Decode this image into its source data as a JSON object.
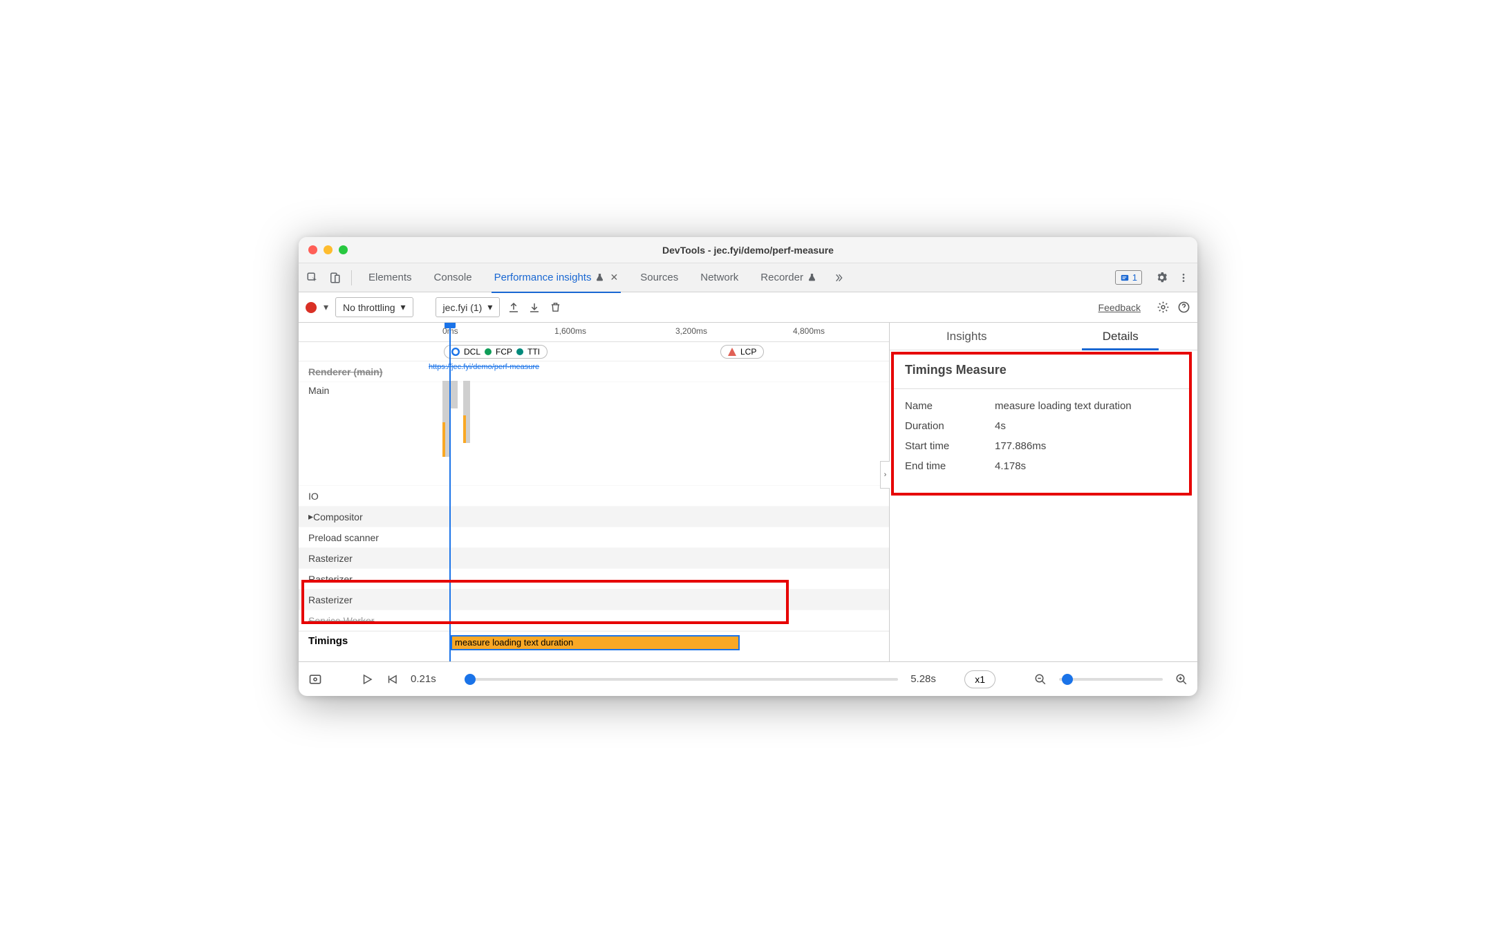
{
  "window": {
    "title": "DevTools - jec.fyi/demo/perf-measure"
  },
  "tabs": {
    "elements": "Elements",
    "console": "Console",
    "perf_insights": "Performance insights",
    "sources": "Sources",
    "network": "Network",
    "recorder": "Recorder",
    "issues_count": "1"
  },
  "toolbar": {
    "throttling": "No throttling",
    "recording": "jec.fyi (1)",
    "feedback": "Feedback"
  },
  "ruler": {
    "t0": "0ms",
    "t1": "1,600ms",
    "t2": "3,200ms",
    "t3": "4,800ms"
  },
  "markers": {
    "dcl": "DCL",
    "fcp": "FCP",
    "tti": "TTI",
    "lcp": "LCP"
  },
  "url_hint": "https://jec.fyi/demo/perf-measure",
  "tracks": {
    "renderer": "Renderer (main)",
    "main": "Main",
    "io": "IO",
    "compositor": "Compositor",
    "preload": "Preload scanner",
    "rasterizer": "Rasterizer",
    "service_worker": "Service Worker",
    "timings": "Timings"
  },
  "measure_bar_label": "measure loading text duration",
  "side": {
    "tab_insights": "Insights",
    "tab_details": "Details",
    "title": "Timings Measure",
    "name_k": "Name",
    "name_v": "measure loading text duration",
    "dur_k": "Duration",
    "dur_v": "4s",
    "start_k": "Start time",
    "start_v": "177.886ms",
    "end_k": "End time",
    "end_v": "4.178s"
  },
  "bottom": {
    "start": "0.21s",
    "end": "5.28s",
    "speed": "x1"
  }
}
